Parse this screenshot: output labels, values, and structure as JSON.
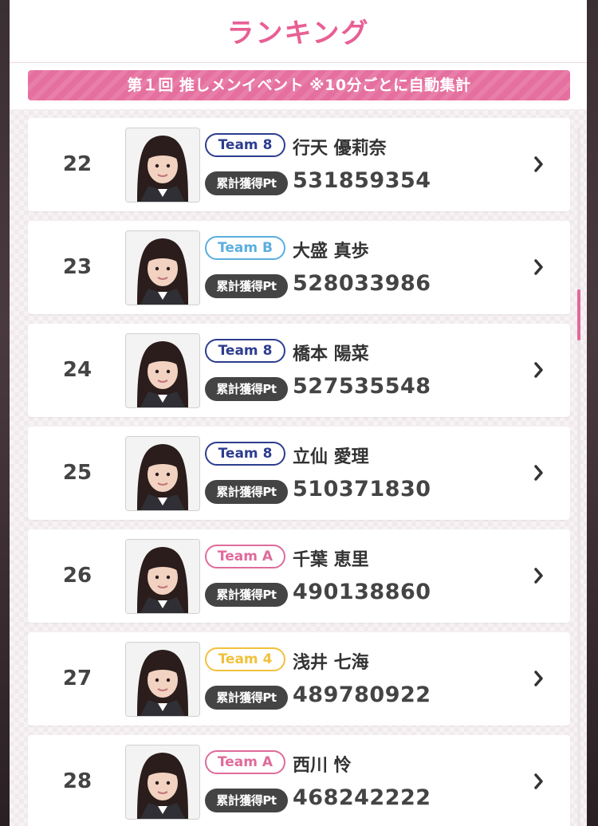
{
  "header": {
    "title": "ランキング",
    "event_banner": "第１回 推しメンイベント ※10分ごとに自動集計"
  },
  "colors": {
    "accent_pink": "#e85f94",
    "banner_pink": "#e5709f",
    "team_8": "#2d3d8f",
    "team_b": "#5aaee0",
    "team_a": "#df6b9b",
    "team_4": "#f0c13c",
    "pt_label_bg": "#444444"
  },
  "ranking": {
    "pt_label": "累計獲得Pt",
    "rows": [
      {
        "rank": "22",
        "team": "Team 8",
        "team_color": "#2d3d8f",
        "name": "行天 優莉奈",
        "points": "531859354"
      },
      {
        "rank": "23",
        "team": "Team B",
        "team_color": "#5aaee0",
        "name": "大盛 真歩",
        "points": "528033986"
      },
      {
        "rank": "24",
        "team": "Team 8",
        "team_color": "#2d3d8f",
        "name": "橋本 陽菜",
        "points": "527535548"
      },
      {
        "rank": "25",
        "team": "Team 8",
        "team_color": "#2d3d8f",
        "name": "立仙 愛理",
        "points": "510371830"
      },
      {
        "rank": "26",
        "team": "Team A",
        "team_color": "#df6b9b",
        "name": "千葉 恵里",
        "points": "490138860"
      },
      {
        "rank": "27",
        "team": "Team 4",
        "team_color": "#f0c13c",
        "name": "浅井 七海",
        "points": "489780922"
      },
      {
        "rank": "28",
        "team": "Team A",
        "team_color": "#df6b9b",
        "name": "西川 怜",
        "points": "468242222"
      }
    ]
  }
}
